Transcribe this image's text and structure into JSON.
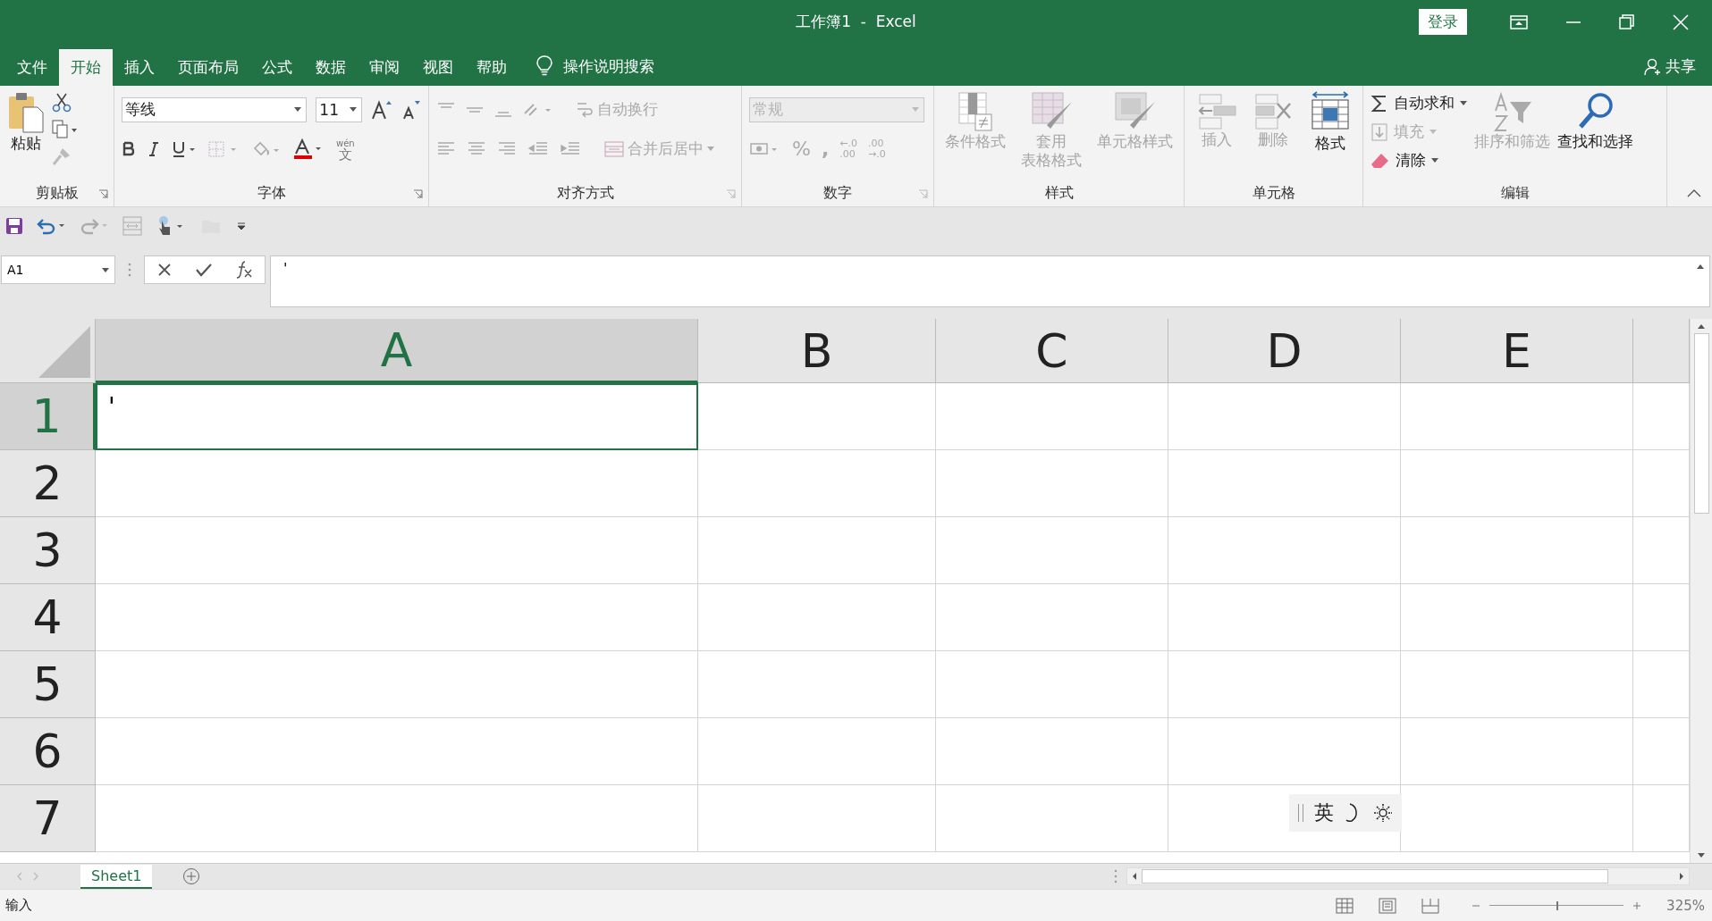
{
  "window": {
    "title": "工作簿1  -  Excel",
    "sign_in": "登录"
  },
  "menu_tabs": [
    {
      "label": "文件",
      "selected": false
    },
    {
      "label": "开始",
      "selected": true
    },
    {
      "label": "插入",
      "selected": false
    },
    {
      "label": "页面布局",
      "selected": false
    },
    {
      "label": "公式",
      "selected": false
    },
    {
      "label": "数据",
      "selected": false
    },
    {
      "label": "审阅",
      "selected": false
    },
    {
      "label": "视图",
      "selected": false
    },
    {
      "label": "帮助",
      "selected": false
    }
  ],
  "tell_me": "操作说明搜索",
  "share": "共享",
  "ribbon": {
    "clipboard": {
      "paste": "粘贴",
      "label": "剪贴板"
    },
    "font": {
      "font_name": "等线",
      "font_size": "11",
      "phonetic": [
        "wén",
        "文"
      ],
      "label": "字体"
    },
    "alignment": {
      "wrap_text": "自动换行",
      "merge": "合并后居中",
      "label": "对齐方式"
    },
    "number": {
      "format": "常规",
      "percent": "%",
      "comma": ",",
      "increase_decimal": [
        "←.0",
        ".00"
      ],
      "decrease_decimal": [
        ".00",
        "→.0"
      ],
      "label": "数字"
    },
    "styles": {
      "items": [
        {
          "label": "条件格式",
          "disabled": true
        },
        {
          "label": "套用",
          "label_2": "表格格式",
          "disabled": true
        },
        {
          "label": "单元格样式",
          "disabled": true
        }
      ],
      "label": "样式"
    },
    "cells": {
      "items": [
        {
          "label": "插入",
          "disabled": true
        },
        {
          "label": "删除",
          "disabled": true
        },
        {
          "label": "格式",
          "disabled": false
        }
      ],
      "label": "单元格"
    },
    "editing": {
      "autosum": {
        "label": "自动求和",
        "disabled": false
      },
      "fill": {
        "label": "填充",
        "disabled": true
      },
      "clear": {
        "label": "清除",
        "disabled": false
      },
      "sort": {
        "label": "排序和筛选",
        "disabled": true
      },
      "find": {
        "label": "查找和选择",
        "disabled": false
      },
      "label": "编辑"
    }
  },
  "formula_bar": {
    "name_box": "A1",
    "value": "'"
  },
  "grid": {
    "columns": [
      {
        "label": "A",
        "selected": true
      },
      {
        "label": "B",
        "selected": false
      },
      {
        "label": "C",
        "selected": false
      },
      {
        "label": "D",
        "selected": false
      },
      {
        "label": "E",
        "selected": false
      }
    ],
    "rows": [
      {
        "label": "1",
        "selected": true,
        "cells": [
          "'",
          "",
          "",
          "",
          ""
        ]
      },
      {
        "label": "2",
        "selected": false,
        "cells": [
          "",
          "",
          "",
          "",
          ""
        ]
      },
      {
        "label": "3",
        "selected": false,
        "cells": [
          "",
          "",
          "",
          "",
          ""
        ]
      },
      {
        "label": "4",
        "selected": false,
        "cells": [
          "",
          "",
          "",
          "",
          ""
        ]
      },
      {
        "label": "5",
        "selected": false,
        "cells": [
          "",
          "",
          "",
          "",
          ""
        ]
      },
      {
        "label": "6",
        "selected": false,
        "cells": [
          "",
          "",
          "",
          "",
          ""
        ]
      },
      {
        "label": "7",
        "selected": false,
        "cells": [
          "",
          "",
          "",
          "",
          ""
        ]
      }
    ]
  },
  "sheet_tabs": [
    {
      "label": "Sheet1",
      "selected": true
    }
  ],
  "status_bar": {
    "mode": "输入",
    "zoom": "325%",
    "zoom_level": {
      "level": 0.5
    }
  },
  "ime_toolbar": {
    "language": "英"
  }
}
